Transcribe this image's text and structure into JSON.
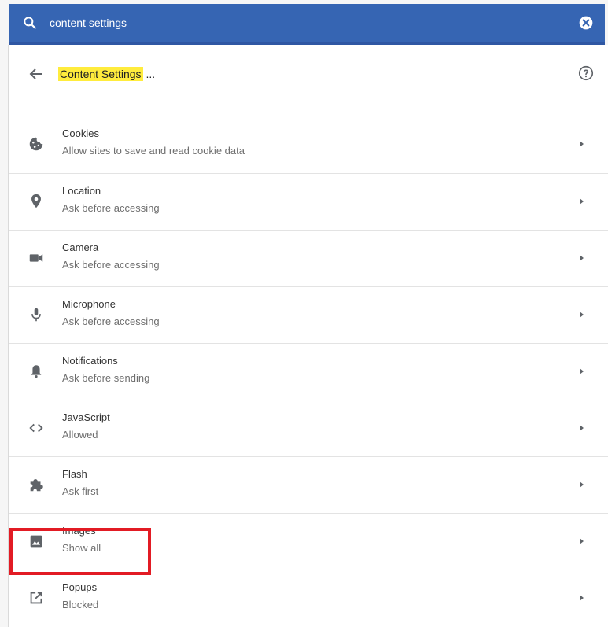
{
  "search": {
    "query": "content settings"
  },
  "header": {
    "title_highlight": "Content Settings",
    "title_rest": "..."
  },
  "rows": [
    {
      "title": "Cookies",
      "subtitle": "Allow sites to save and read cookie data",
      "icon": "cookie-icon"
    },
    {
      "title": "Location",
      "subtitle": "Ask before accessing",
      "icon": "location-pin-icon"
    },
    {
      "title": "Camera",
      "subtitle": "Ask before accessing",
      "icon": "camera-icon"
    },
    {
      "title": "Microphone",
      "subtitle": "Ask before accessing",
      "icon": "microphone-icon"
    },
    {
      "title": "Notifications",
      "subtitle": "Ask before sending",
      "icon": "bell-icon"
    },
    {
      "title": "JavaScript",
      "subtitle": "Allowed",
      "icon": "code-icon"
    },
    {
      "title": "Flash",
      "subtitle": "Ask first",
      "icon": "puzzle-icon"
    },
    {
      "title": "Images",
      "subtitle": "Show all",
      "icon": "image-icon"
    },
    {
      "title": "Popups",
      "subtitle": "Blocked",
      "icon": "open-in-new-icon"
    }
  ],
  "colors": {
    "search_bar": "#3665b3",
    "title_highlight": "#ffec3d",
    "annotation_box": "#e21b24",
    "icon": "#5f6368"
  }
}
